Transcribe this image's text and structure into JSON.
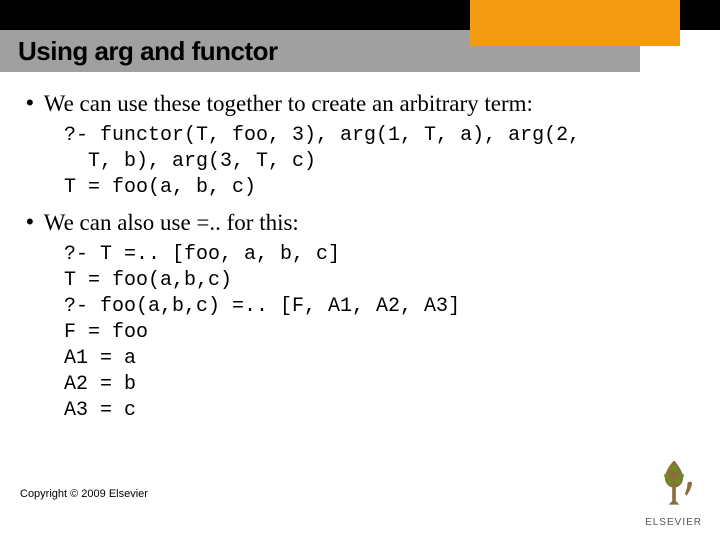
{
  "header": {
    "title": "Using arg and functor"
  },
  "body": {
    "bullet1": "We can use these together to create an arbitrary term:",
    "code1": "?- functor(T, foo, 3), arg(1, T, a), arg(2,\n  T, b), arg(3, T, c)\nT = foo(a, b, c)",
    "bullet2": "We can also use =.. for this:",
    "code2": "?- T =.. [foo, a, b, c]\nT = foo(a,b,c)\n?- foo(a,b,c) =.. [F, A1, A2, A3]\nF = foo\nA1 = a\nA2 = b\nA3 = c"
  },
  "footer": {
    "copyright": "Copyright © 2009 Elsevier",
    "publisher": "ELSEVIER"
  }
}
